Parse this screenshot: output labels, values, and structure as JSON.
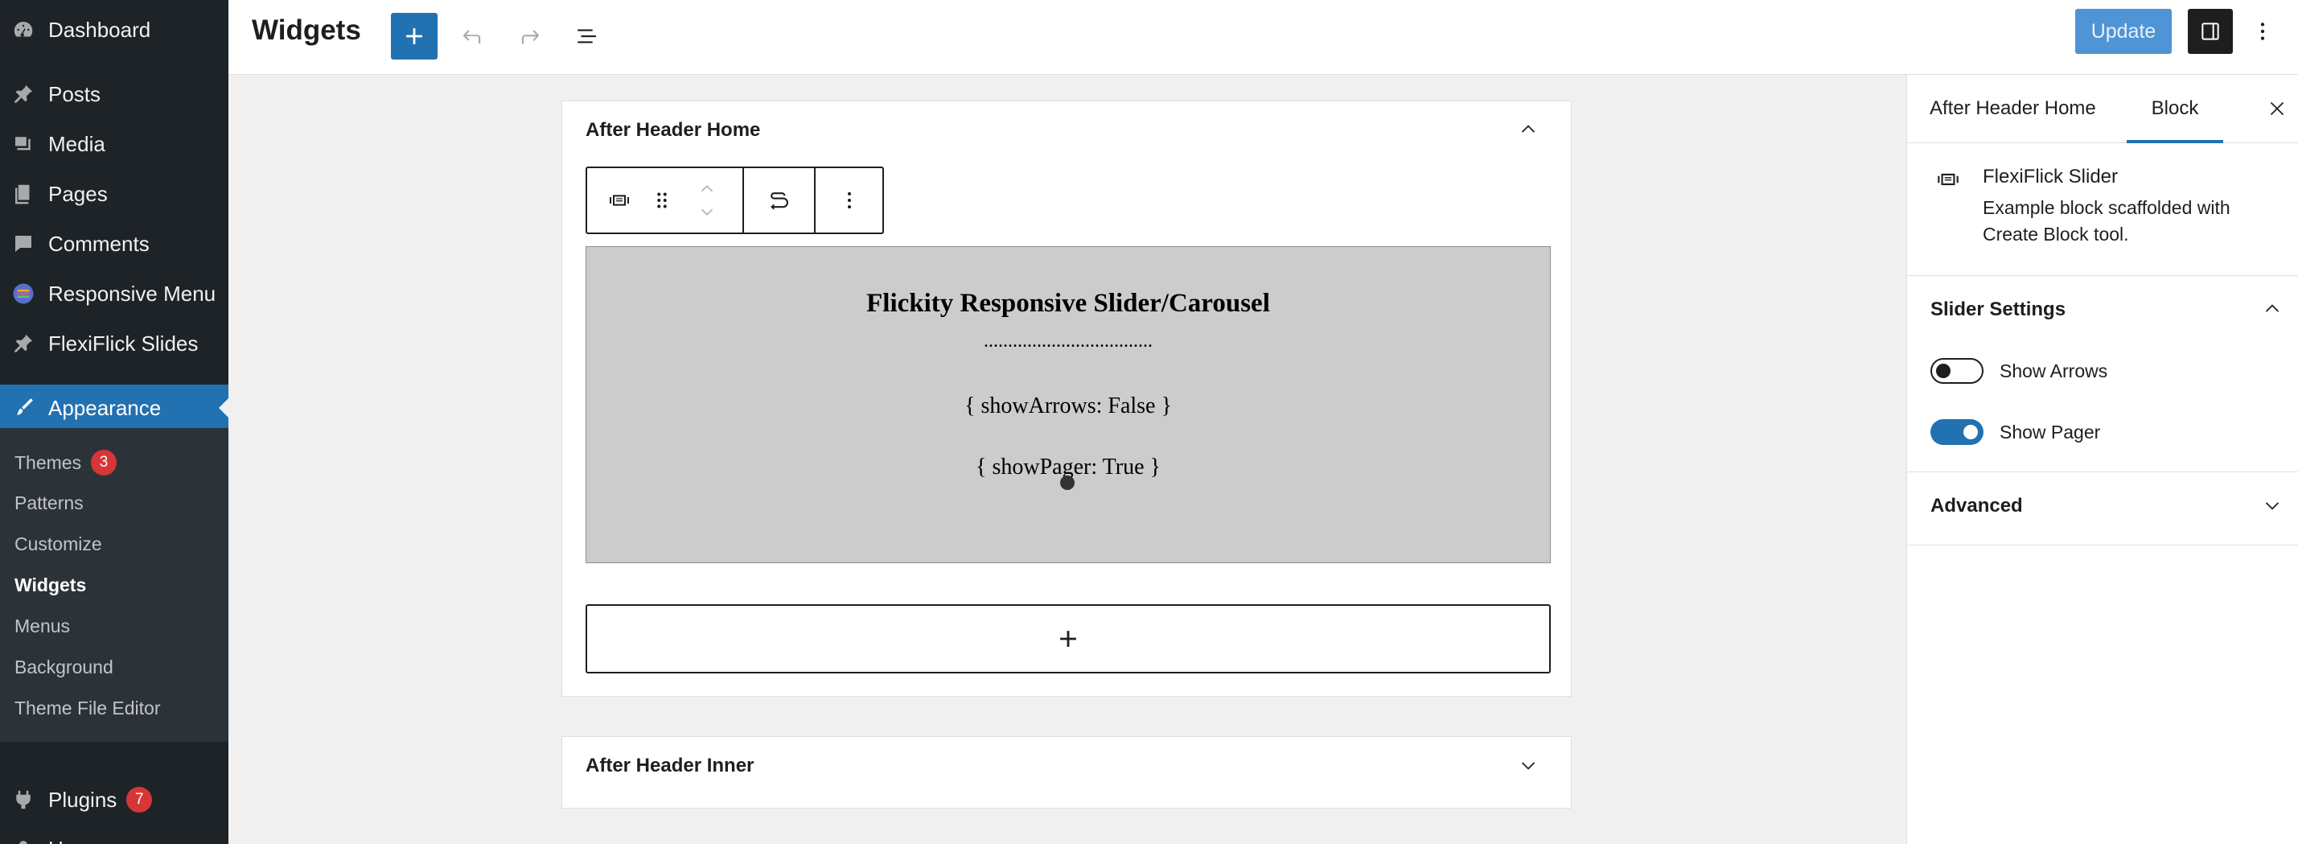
{
  "admin_menu": {
    "items": [
      {
        "label": "Dashboard",
        "icon": "dashboard-icon"
      },
      {
        "label": "Posts",
        "icon": "pin-icon"
      },
      {
        "label": "Media",
        "icon": "media-icon"
      },
      {
        "label": "Pages",
        "icon": "pages-icon"
      },
      {
        "label": "Comments",
        "icon": "comment-icon"
      },
      {
        "label": "Responsive Menu",
        "icon": "responsive-menu-logo-icon"
      },
      {
        "label": "FlexiFlick Slides",
        "icon": "pin-icon"
      },
      {
        "label": "Appearance",
        "icon": "paintbrush-icon"
      },
      {
        "label": "Plugins",
        "icon": "plugin-icon"
      },
      {
        "label": "Users",
        "icon": "users-icon"
      }
    ],
    "submenu": [
      {
        "label": "Themes",
        "badge": "3"
      },
      {
        "label": "Patterns"
      },
      {
        "label": "Customize"
      },
      {
        "label": "Widgets"
      },
      {
        "label": "Menus"
      },
      {
        "label": "Background"
      },
      {
        "label": "Theme File Editor"
      }
    ],
    "plugins_badge": "7"
  },
  "header": {
    "title": "Widgets",
    "update_label": "Update",
    "icons": [
      "plus-icon",
      "undo-icon",
      "redo-icon",
      "list-view-icon",
      "sidebar-toggle-icon",
      "more-vertical-icon"
    ]
  },
  "editor": {
    "area_title": "After Header Home",
    "block": {
      "title": "Flickity Responsive Slider/Carousel",
      "dots": "...................................",
      "line1": "{ showArrows: False }",
      "line2": "{ showPager: True }"
    },
    "area2_title": "After Header Inner"
  },
  "settings": {
    "tabs": [
      "After Header Home",
      "Block"
    ],
    "active_tab": "Block",
    "card_title": "FlexiFlick Slider",
    "card_desc": "Example block scaffolded with Create Block tool.",
    "panel_title": "Slider Settings",
    "toggles": [
      {
        "label": "Show Arrows",
        "on": false
      },
      {
        "label": "Show Pager",
        "on": true
      }
    ],
    "advanced_title": "Advanced"
  },
  "colors": {
    "admin_bar": "#1d2327",
    "accent": "#2271b1",
    "badge": "#d63638"
  }
}
